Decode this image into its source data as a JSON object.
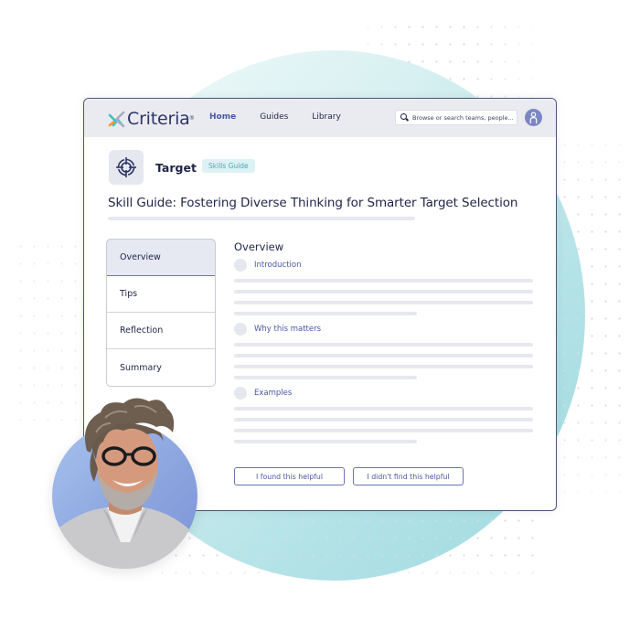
{
  "brand": {
    "name": "Criteria",
    "colors": {
      "navy": "#1f2547",
      "accent": "#4a55a8",
      "teal": "#45aab4",
      "logo_teal": "#3fc0c8",
      "logo_orange": "#f39a2e",
      "logo_grey": "#a9aec2"
    }
  },
  "nav": {
    "items": [
      {
        "label": "Home",
        "active": true
      },
      {
        "label": "Guides",
        "active": false
      },
      {
        "label": "Library",
        "active": false
      }
    ]
  },
  "search": {
    "placeholder": "Browse or search teams, people..."
  },
  "user": {
    "avatar_icon": "user-icon"
  },
  "header": {
    "category_icon": "target-icon",
    "category": "Target",
    "badge": "Skills Guide",
    "title": "Skill Guide: Fostering Diverse Thinking for Smarter Target Selection"
  },
  "tabs": [
    {
      "label": "Overview",
      "active": true
    },
    {
      "label": "Tips",
      "active": false
    },
    {
      "label": "Reflection",
      "active": false
    },
    {
      "label": "Summary",
      "active": false
    }
  ],
  "main": {
    "heading": "Overview",
    "sections": [
      {
        "label": "Introduction"
      },
      {
        "label": "Why this matters"
      },
      {
        "label": "Examples"
      }
    ]
  },
  "feedback": {
    "helpful_label": "I found this helpful",
    "not_helpful_label": "I didn't find this helpful"
  },
  "portrait": {
    "description": "Smiling man with curly grey hair, glasses and beard"
  }
}
